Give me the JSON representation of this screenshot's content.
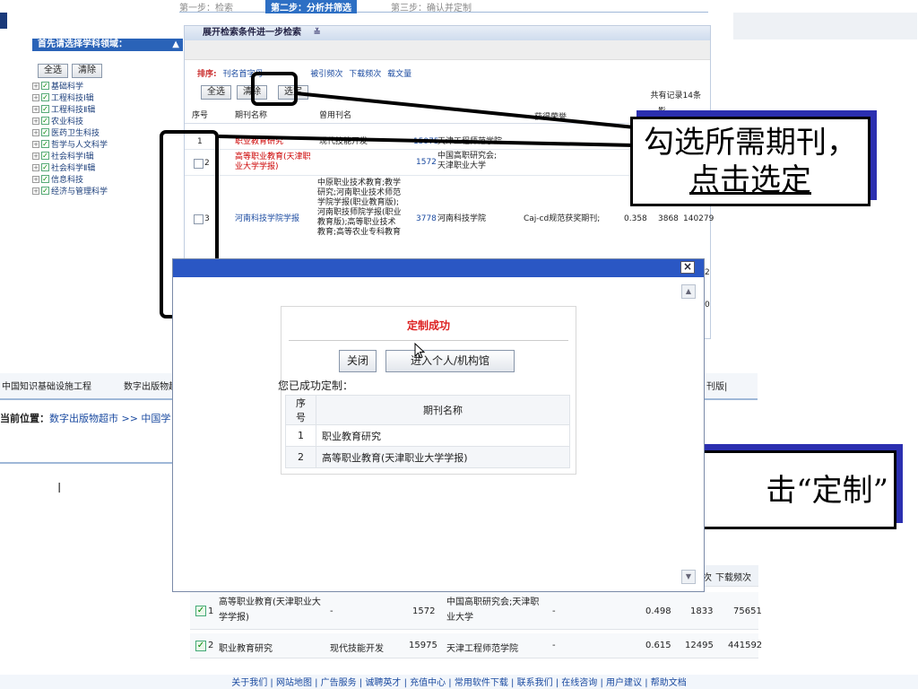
{
  "steps": {
    "s1": "第一步：检索",
    "s2": "第二步：分析并筛选",
    "s3": "第三步：确认并定制"
  },
  "sidebar": {
    "header": "首先请选择学科领域：",
    "btn_all": "全选",
    "btn_clear": "清除",
    "items": [
      "基础科学",
      "工程科技Ⅰ辑",
      "工程科技Ⅱ辑",
      "农业科技",
      "医药卫生科技",
      "哲学与人文科学",
      "社会科学Ⅰ辑",
      "社会科学Ⅱ辑",
      "信息科技",
      "经济与管理科学"
    ]
  },
  "panel": {
    "header": "展开检索条件进一步检索",
    "sort_label": "排序:",
    "sort_items": [
      "刊名首字母",
      "被引频次",
      "下载频次",
      "载文量"
    ],
    "btn_all": "全选",
    "btn_clear": "清除",
    "btn_select": "选定",
    "total": "共有记录14条",
    "cols": {
      "no": "序号",
      "name": "期刊名称",
      "former": "曾用刊名",
      "honor": "获得荣誉",
      "impact": "影响因子",
      "cited": "被引频次",
      "downloads": "下载频次"
    },
    "rows": [
      {
        "no": "1",
        "name": "职业教育研究",
        "former": "现代技能开发",
        "count": "15975",
        "sponsor": "天津工程师范学院"
      },
      {
        "no": "2",
        "name": "高等职业教育(天津职业大学学报)",
        "count": "1572",
        "sponsor": "中国高职研究会;天津职业大学"
      },
      {
        "no": "3",
        "name": "河南科技学院学报",
        "former": "中原职业技术教育;教学研究;河南职业技术师范学院学报(职业教育版);河南职技师院学报(职业教育版);高等职业技术教育;高等农业专科教育",
        "count": "3778",
        "sponsor": "河南科技学院",
        "honor": "Caj-cd规范获奖期刊;",
        "impact": "0.358",
        "cited": "3868",
        "downloads": "140279"
      }
    ]
  },
  "callout1": {
    "line1": "勾选所需期刊，",
    "line2": "点击选定"
  },
  "callout2": {
    "text": "点击“定制”",
    "visible": "击“定制”"
  },
  "bg": {
    "nav": "中国知识基础设施工程",
    "nav2": "数字出版物超市",
    "location_label": "当前位置：",
    "location": "数字出版物超市 >> 中国学",
    "right": "刊版|"
  },
  "dialog": {
    "success": "定制成功",
    "btn_close": "关闭",
    "btn_enter": "进入个人/机构馆",
    "done_label": "您已成功定制：",
    "col_no": "序号",
    "col_name": "期刊名称",
    "rows": [
      {
        "no": "1",
        "name": "职业教育研究"
      },
      {
        "no": "2",
        "name": "高等职业教育(天津职业大学学报)"
      }
    ]
  },
  "bottom": {
    "col_cited": "次",
    "col_downloads": "下载频次",
    "rows": [
      {
        "no": "1",
        "name": "高等职业教育(天津职业大学学报)",
        "former": "-",
        "count": "1572",
        "sponsor": "中国高职研究会;天津职业大学",
        "honor": "-",
        "impact": "0.498",
        "cited": "1833",
        "downloads": "75651"
      },
      {
        "no": "2",
        "name": "职业教育研究",
        "former": "现代技能开发",
        "count": "15975",
        "sponsor": "天津工程师范学院",
        "honor": "-",
        "impact": "0.615",
        "cited": "12495",
        "downloads": "441592"
      }
    ]
  },
  "footer": {
    "text": "关于我们 | 网站地图 | 广告服务 | 诚聘英才 | 充值中心 | 常用软件下载 | 联系我们 | 在线咨询 | 用户建议 | 帮助文档"
  }
}
